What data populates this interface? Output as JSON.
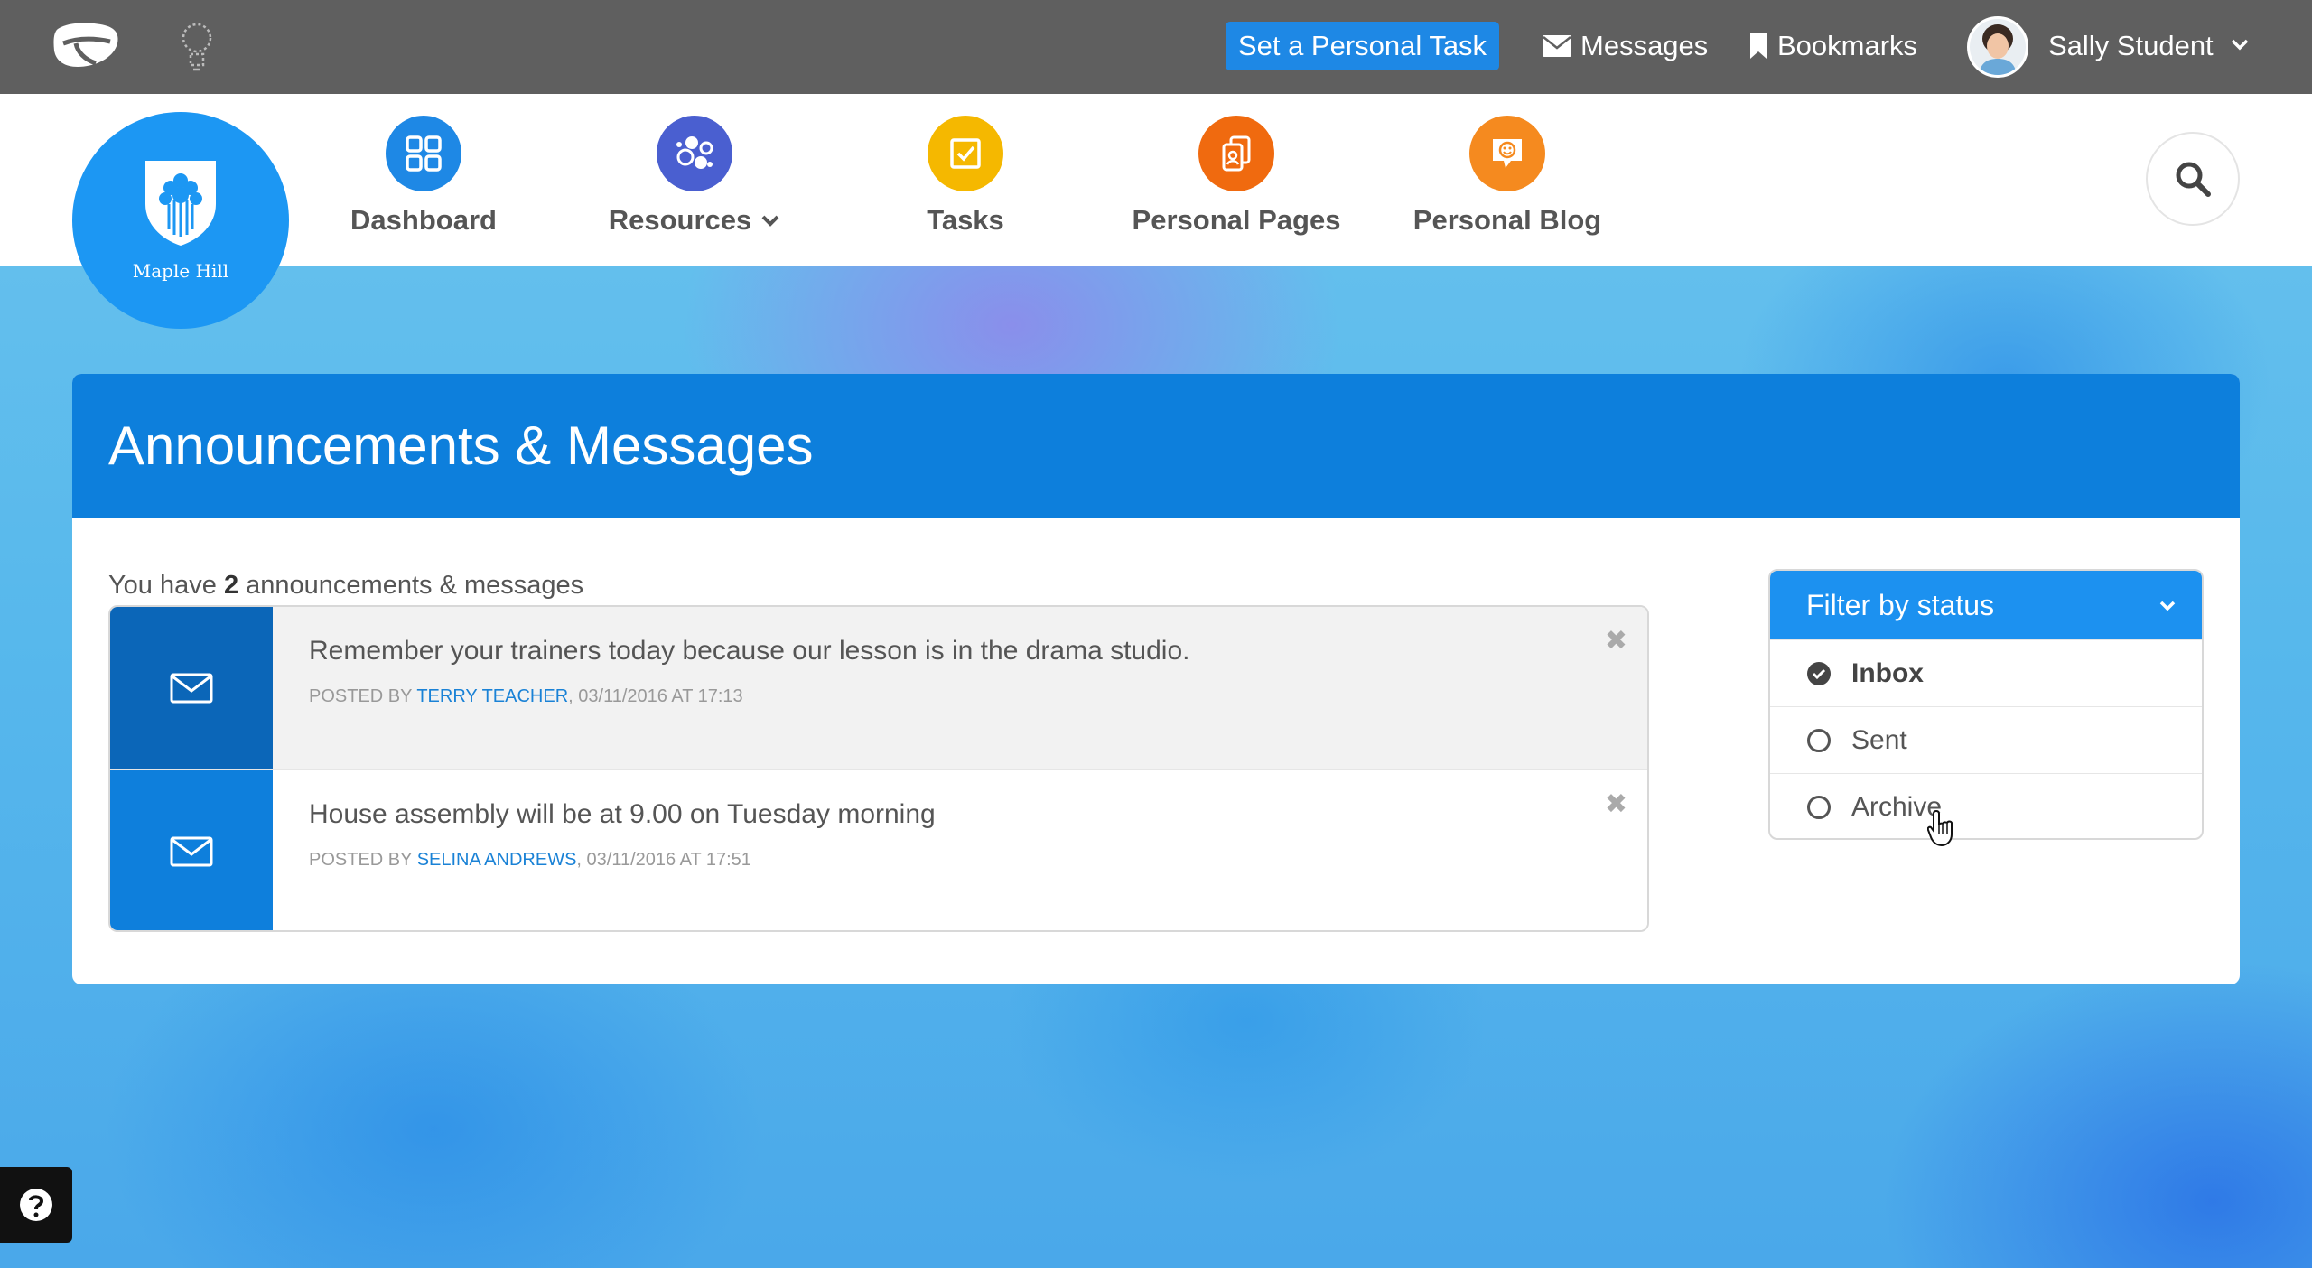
{
  "topbar": {
    "personal_task_label": "Set a Personal Task",
    "messages_label": "Messages",
    "bookmarks_label": "Bookmarks",
    "user_name": "Sally Student"
  },
  "school": {
    "name": "Maple Hill"
  },
  "nav": {
    "items": [
      {
        "label": "Dashboard",
        "icon": "grid-icon",
        "color": "#1e88e5"
      },
      {
        "label": "Resources",
        "icon": "bubbles-icon",
        "color": "#4a5fd0"
      },
      {
        "label": "Tasks",
        "icon": "checkbox-icon",
        "color": "#f5b800"
      },
      {
        "label": "Personal Pages",
        "icon": "pages-icon",
        "color": "#f06a0f"
      },
      {
        "label": "Personal Blog",
        "icon": "blog-icon",
        "color": "#f58a1f"
      }
    ]
  },
  "page": {
    "title": "Announcements & Messages",
    "count_prefix": "You have",
    "count": "2",
    "count_suffix": "announcements & messages"
  },
  "messages": [
    {
      "title": "Remember your trainers today because our lesson is in the drama studio.",
      "posted_by_label": "POSTED BY",
      "author": "TERRY TEACHER",
      "date": ", 03/11/2016 AT 17:13",
      "status": "unread"
    },
    {
      "title": "House assembly will be at 9.00 on Tuesday morning",
      "posted_by_label": "POSTED BY",
      "author": "SELINA ANDREWS",
      "date": ", 03/11/2016 AT 17:51",
      "status": "read"
    }
  ],
  "filter": {
    "heading": "Filter by status",
    "options": [
      {
        "label": "Inbox",
        "selected": true
      },
      {
        "label": "Sent",
        "selected": false
      },
      {
        "label": "Archive",
        "selected": false
      }
    ]
  },
  "colors": {
    "topbar": "#5f5f5f",
    "primary": "#0d7fdc",
    "accent": "#1e88e5"
  }
}
